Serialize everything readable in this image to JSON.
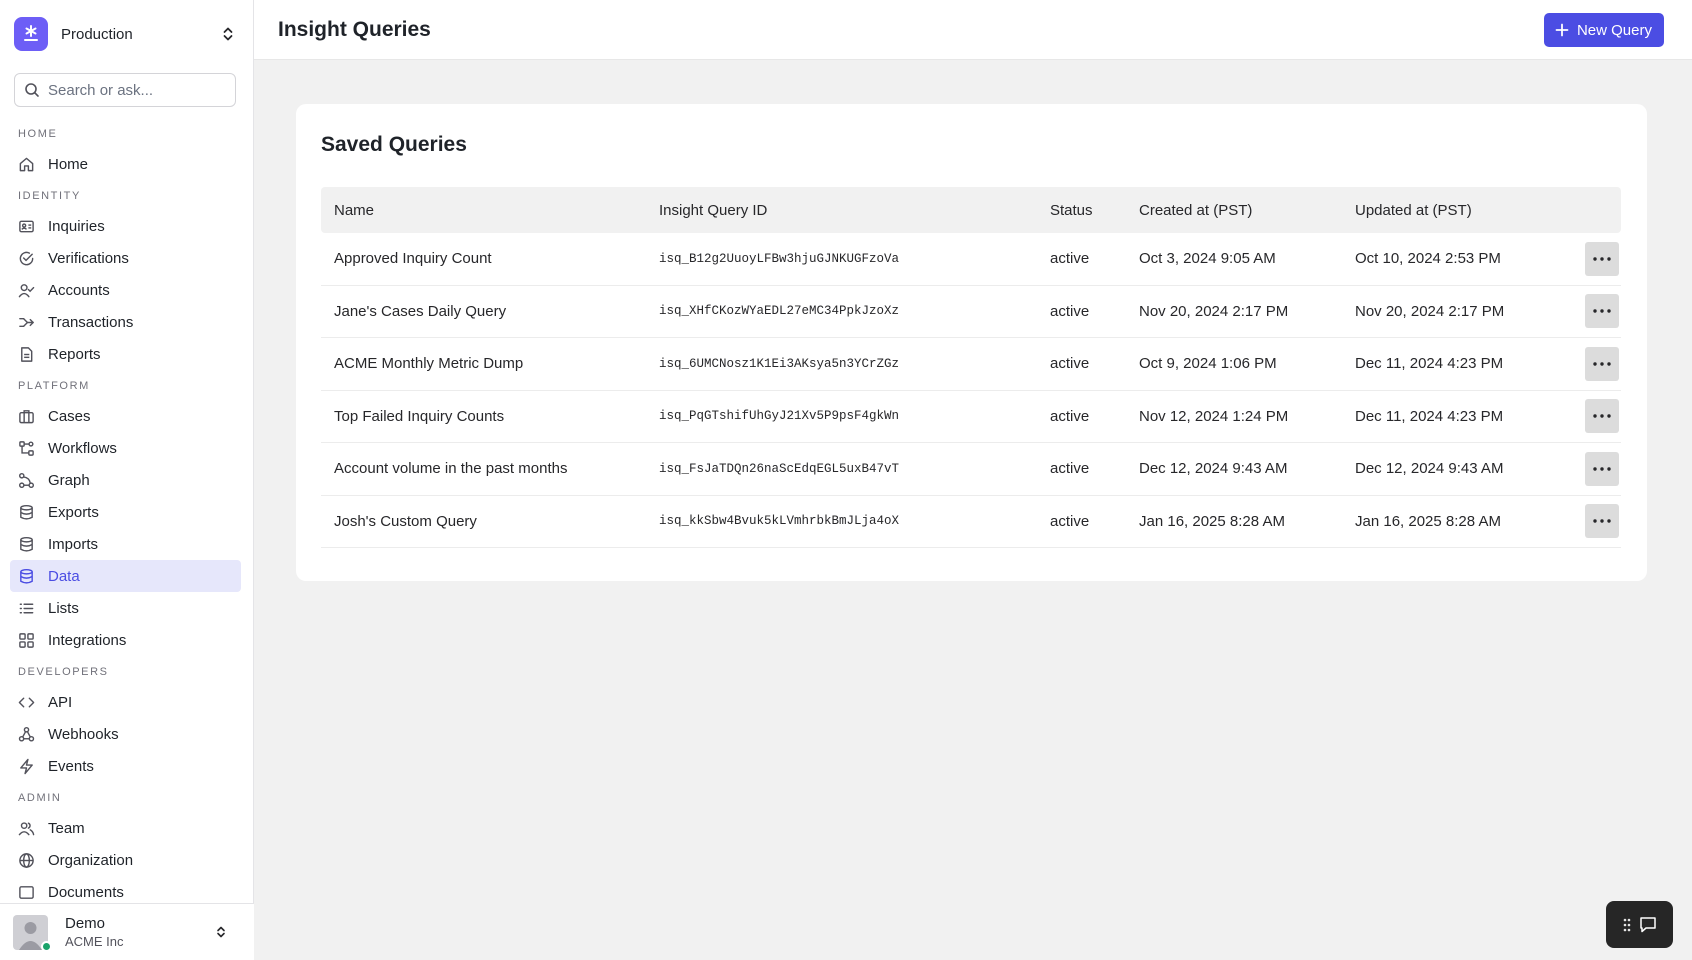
{
  "workspace": {
    "name": "Production"
  },
  "search": {
    "placeholder": "Search or ask..."
  },
  "nav": {
    "home_section": "HOME",
    "home": "Home",
    "identity_section": "IDENTITY",
    "inquiries": "Inquiries",
    "verifications": "Verifications",
    "accounts": "Accounts",
    "transactions": "Transactions",
    "reports": "Reports",
    "platform_section": "PLATFORM",
    "cases": "Cases",
    "workflows": "Workflows",
    "graph": "Graph",
    "exports": "Exports",
    "imports": "Imports",
    "data": "Data",
    "lists": "Lists",
    "integrations": "Integrations",
    "developers_section": "DEVELOPERS",
    "api": "API",
    "webhooks": "Webhooks",
    "events": "Events",
    "admin_section": "ADMIN",
    "team": "Team",
    "organization": "Organization",
    "truncated": "Documents"
  },
  "user": {
    "name": "Demo",
    "org": "ACME Inc"
  },
  "header": {
    "title": "Insight Queries",
    "new_button": "New Query"
  },
  "card": {
    "title": "Saved Queries"
  },
  "table": {
    "columns": [
      "Name",
      "Insight Query ID",
      "Status",
      "Created at (PST)",
      "Updated at (PST)"
    ],
    "rows": [
      {
        "name": "Approved Inquiry Count",
        "id": "isq_B12g2UuoyLFBw3hjuGJNKUGFzoVa",
        "status": "active",
        "created": "Oct 3, 2024 9:05 AM",
        "updated": "Oct 10, 2024 2:53 PM"
      },
      {
        "name": "Jane's Cases Daily Query",
        "id": "isq_XHfCKozWYaEDL27eMC34PpkJzoXz",
        "status": "active",
        "created": "Nov 20, 2024 2:17 PM",
        "updated": "Nov 20, 2024 2:17 PM"
      },
      {
        "name": "ACME Monthly Metric Dump",
        "id": "isq_6UMCNosz1K1Ei3AKsya5n3YCrZGz",
        "status": "active",
        "created": "Oct 9, 2024 1:06 PM",
        "updated": "Dec 11, 2024 4:23 PM"
      },
      {
        "name": "Top Failed Inquiry Counts",
        "id": "isq_PqGTshifUhGyJ21Xv5P9psF4gkWn",
        "status": "active",
        "created": "Nov 12, 2024 1:24 PM",
        "updated": "Dec 11, 2024 4:23 PM"
      },
      {
        "name": "Account volume in the past months",
        "id": "isq_FsJaTDQn26naScEdqEGL5uxB47vT",
        "status": "active",
        "created": "Dec 12, 2024 9:43 AM",
        "updated": "Dec 12, 2024 9:43 AM"
      },
      {
        "name": "Josh's Custom Query",
        "id": "isq_kkSbw4Bvuk5kLVmhrbkBmJLja4oX",
        "status": "active",
        "created": "Jan 16, 2025 8:28 AM",
        "updated": "Jan 16, 2025 8:28 AM"
      }
    ]
  },
  "colors": {
    "accent": "#4b4de3",
    "logo": "#6d5ef6",
    "online": "#1aa36a"
  }
}
